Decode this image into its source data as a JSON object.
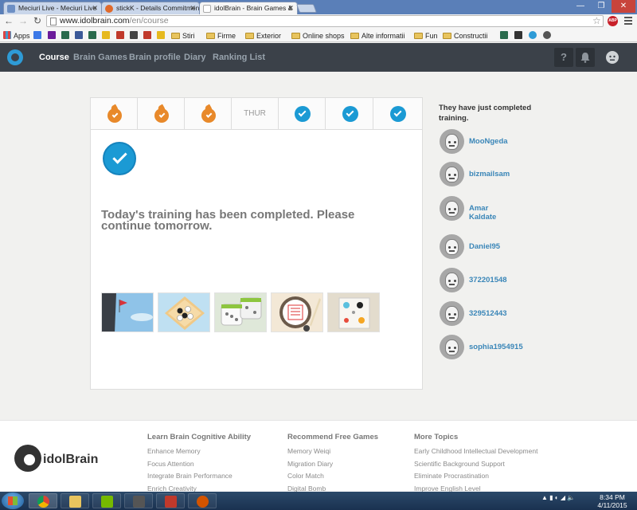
{
  "browser": {
    "tabs": [
      {
        "title": "Meciuri Live - Meciuri Live",
        "icon": "page-icon",
        "color": "#6d8fc4"
      },
      {
        "title": "stickK - Details Commitment",
        "icon": "stickk-icon",
        "color": "#e06a2b"
      },
      {
        "title": "idolBrain - Brain Games &",
        "icon": "idolbrain-icon",
        "color": "#2e9bd6"
      }
    ],
    "url_host": "www.idolbrain.com",
    "url_path": "/en/course",
    "bookmarks": [
      {
        "label": "Apps",
        "type": "apps"
      },
      {
        "label": "",
        "type": "google",
        "color": "#3b78e7"
      },
      {
        "label": "",
        "type": "yahoo",
        "color": "#6b1b9a"
      },
      {
        "label": "",
        "type": "site",
        "color": "#2a6b4d"
      },
      {
        "label": "",
        "type": "facebook",
        "color": "#3b5998"
      },
      {
        "label": "",
        "type": "site",
        "color": "#2a6b4d"
      },
      {
        "label": "",
        "type": "imdb",
        "color": "#e6b91e"
      },
      {
        "label": "",
        "type": "site",
        "color": "#c0392b"
      },
      {
        "label": "",
        "type": "site",
        "color": "#444444"
      },
      {
        "label": "",
        "type": "site",
        "color": "#c0392b"
      },
      {
        "label": "",
        "type": "site",
        "color": "#e6b91e"
      },
      {
        "label": "Stiri",
        "type": "folder"
      },
      {
        "label": "Firme",
        "type": "folder"
      },
      {
        "label": "Exterior",
        "type": "folder"
      },
      {
        "label": "Online shops",
        "type": "folder"
      },
      {
        "label": "Alte informatii",
        "type": "folder"
      },
      {
        "label": "Fun",
        "type": "folder"
      },
      {
        "label": "Constructii",
        "type": "folder"
      }
    ]
  },
  "header": {
    "nav": [
      {
        "label": "Course",
        "active": true
      },
      {
        "label": "Brain Games",
        "active": false
      },
      {
        "label": "Brain profile",
        "active": false
      },
      {
        "label": "Diary",
        "active": false
      },
      {
        "label": "Ranking List",
        "active": false
      }
    ],
    "help_label": "?"
  },
  "course": {
    "days": [
      {
        "status": "flame",
        "label": ""
      },
      {
        "status": "flame",
        "label": ""
      },
      {
        "status": "flame",
        "label": ""
      },
      {
        "status": "label",
        "label": "THUR"
      },
      {
        "status": "check",
        "label": ""
      },
      {
        "status": "check",
        "label": ""
      },
      {
        "status": "check",
        "label": ""
      }
    ],
    "message": "Today's training has been completed. Please continue tomorrow.",
    "games": [
      {
        "name": "game-thumbnail-climb",
        "bg": "#8fc3e8"
      },
      {
        "name": "game-thumbnail-weiqi",
        "bg": "#bfe0f2"
      },
      {
        "name": "game-thumbnail-dice",
        "bg": "#dfe8d9"
      },
      {
        "name": "game-thumbnail-memo",
        "bg": "#f3e8d6"
      },
      {
        "name": "game-thumbnail-board",
        "bg": "#e3dccd"
      }
    ]
  },
  "recent": {
    "title": "They have just completed training.",
    "users": [
      "MooNgeda",
      "bizmailsam",
      "Amar Kaldate",
      "Daniel95",
      "372201548",
      "329512443",
      "sophia1954915"
    ]
  },
  "footer": {
    "brand": "idolBrain",
    "columns": [
      {
        "title": "Learn Brain Cognitive Ability",
        "links": [
          "Enhance Memory",
          "Focus Attention",
          "Integrate Brain Performance",
          "Enrich Creativity"
        ]
      },
      {
        "title": "Recommend Free Games",
        "links": [
          "Memory Weiqi",
          "Migration Diary",
          "Color Match",
          "Digital Bomb"
        ]
      },
      {
        "title": "More Topics",
        "links": [
          "Early Childhood Intellectual Development",
          "Scientific Background Support",
          "Eliminate Procrastination",
          "Improve English Level"
        ]
      }
    ]
  },
  "taskbar": {
    "time": "8:34 PM",
    "date": "4/11/2015"
  },
  "colors": {
    "accent_blue": "#1b9ad4",
    "flame_orange": "#e8892a",
    "header_dark": "#3b4149",
    "user_link": "#3a86b8"
  }
}
